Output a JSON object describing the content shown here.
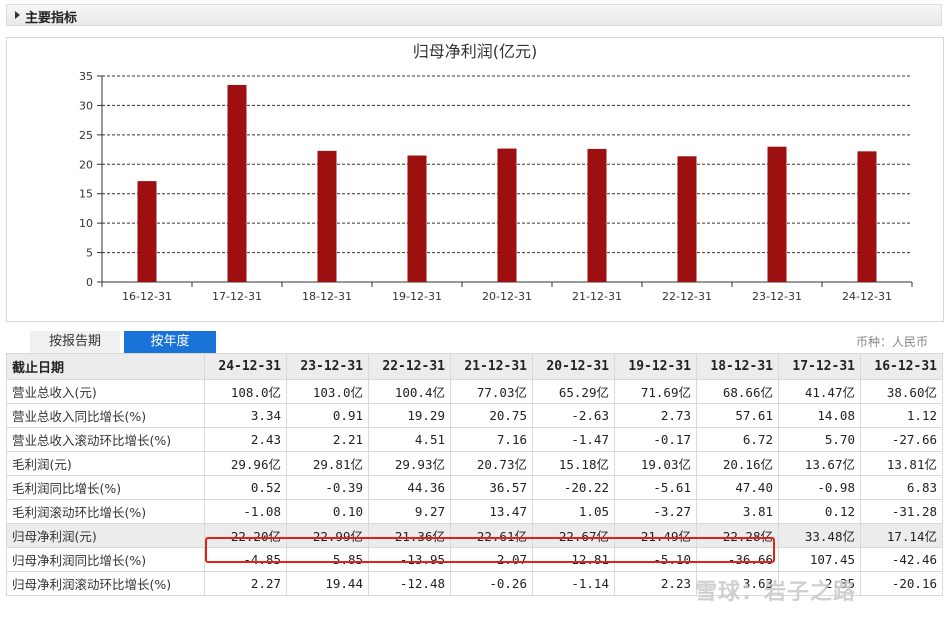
{
  "section": {
    "title": "主要指标"
  },
  "chart_data": {
    "type": "bar",
    "title": "归母净利润(亿元)",
    "categories": [
      "16-12-31",
      "17-12-31",
      "18-12-31",
      "19-12-31",
      "20-12-31",
      "21-12-31",
      "22-12-31",
      "23-12-31",
      "24-12-31"
    ],
    "values": [
      17.14,
      33.48,
      22.28,
      21.49,
      22.67,
      22.61,
      21.36,
      22.99,
      22.2
    ],
    "ylim": [
      0,
      35
    ],
    "yticks": [
      0,
      5,
      10,
      15,
      20,
      25,
      30,
      35
    ],
    "bar_color": "#9e1010",
    "grid": "dashed horizontal"
  },
  "tabs": [
    {
      "label": "按报告期",
      "active": false
    },
    {
      "label": "按年度",
      "active": true
    }
  ],
  "currency": "币种：人民币",
  "table": {
    "header_label": "截止日期",
    "columns": [
      "24-12-31",
      "23-12-31",
      "22-12-31",
      "21-12-31",
      "20-12-31",
      "19-12-31",
      "18-12-31",
      "17-12-31",
      "16-12-31"
    ],
    "rows": [
      {
        "label": "营业总收入(元)",
        "values": [
          "108.0亿",
          "103.0亿",
          "100.4亿",
          "77.03亿",
          "65.29亿",
          "71.69亿",
          "68.66亿",
          "41.47亿",
          "38.60亿"
        ]
      },
      {
        "label": "营业总收入同比增长(%)",
        "values": [
          "3.34",
          "0.91",
          "19.29",
          "20.75",
          "-2.63",
          "2.73",
          "57.61",
          "14.08",
          "1.12"
        ]
      },
      {
        "label": "营业总收入滚动环比增长(%)",
        "values": [
          "2.43",
          "2.21",
          "4.51",
          "7.16",
          "-1.47",
          "-0.17",
          "6.72",
          "5.70",
          "-27.66"
        ]
      },
      {
        "label": "毛利润(元)",
        "values": [
          "29.96亿",
          "29.81亿",
          "29.93亿",
          "20.73亿",
          "15.18亿",
          "19.03亿",
          "20.16亿",
          "13.67亿",
          "13.81亿"
        ]
      },
      {
        "label": "毛利润同比增长(%)",
        "values": [
          "0.52",
          "-0.39",
          "44.36",
          "36.57",
          "-20.22",
          "-5.61",
          "47.40",
          "-0.98",
          "6.83"
        ]
      },
      {
        "label": "毛利润滚动环比增长(%)",
        "values": [
          "-1.08",
          "0.10",
          "9.27",
          "13.47",
          "1.05",
          "-3.27",
          "3.81",
          "0.12",
          "-31.28"
        ]
      },
      {
        "label": "归母净利润(元)",
        "values": [
          "22.20亿",
          "22.99亿",
          "21.36亿",
          "22.61亿",
          "22.67亿",
          "21.49亿",
          "22.28亿",
          "33.48亿",
          "17.14亿"
        ]
      },
      {
        "label": "归母净利润同比增长(%)",
        "values": [
          "-4.85",
          "5.85",
          "-13.95",
          "2.07",
          "12.81",
          "-5.10",
          "-36.66",
          "107.45",
          "-42.46"
        ]
      },
      {
        "label": "归母净利润滚动环比增长(%)",
        "values": [
          "2.27",
          "19.44",
          "-12.48",
          "-0.26",
          "-1.14",
          "2.23",
          "3.63",
          "2.35",
          "-20.16"
        ]
      }
    ]
  },
  "watermark": "雪球：岩子之路"
}
